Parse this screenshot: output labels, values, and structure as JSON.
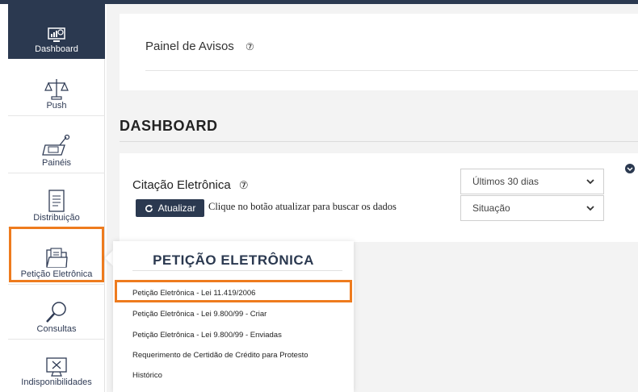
{
  "sidebar": {
    "items": [
      {
        "label": "Dashboard",
        "icon": "dashboard-chart-icon"
      },
      {
        "label": "Push",
        "icon": "scales-icon"
      },
      {
        "label": "Painéis",
        "icon": "panel-board-icon"
      },
      {
        "label": "Distribuição",
        "icon": "document-icon"
      },
      {
        "label": "Petição Eletrônica",
        "icon": "folder-icon"
      },
      {
        "label": "Consultas",
        "icon": "magnifier-icon"
      },
      {
        "label": "Indisponibilidades",
        "icon": "monitor-x-icon"
      }
    ]
  },
  "avisos": {
    "title": "Painel de Avisos",
    "help": "?"
  },
  "dashboard": {
    "title": "DASHBOARD"
  },
  "citacao": {
    "title": "Citação Eletrônica",
    "help": "?",
    "button_label": "Atualizar",
    "message": "Clique no botão atualizar para buscar os dados",
    "period_select": "Últimos 30 dias",
    "status_select": "Situação"
  },
  "popover": {
    "title": "PETIÇÃO ELETRÔNICA",
    "items": [
      "Petição Eletrônica - Lei 11.419/2006",
      "Petição Eletrônica - Lei 9.800/99 - Criar",
      "Petição Eletrônica - Lei 9.800/99 - Enviadas",
      "Requerimento de Certidão de Crédito para Protesto",
      "Histórico"
    ]
  },
  "colors": {
    "navy": "#2b3950",
    "highlight": "#ee7b1e"
  }
}
